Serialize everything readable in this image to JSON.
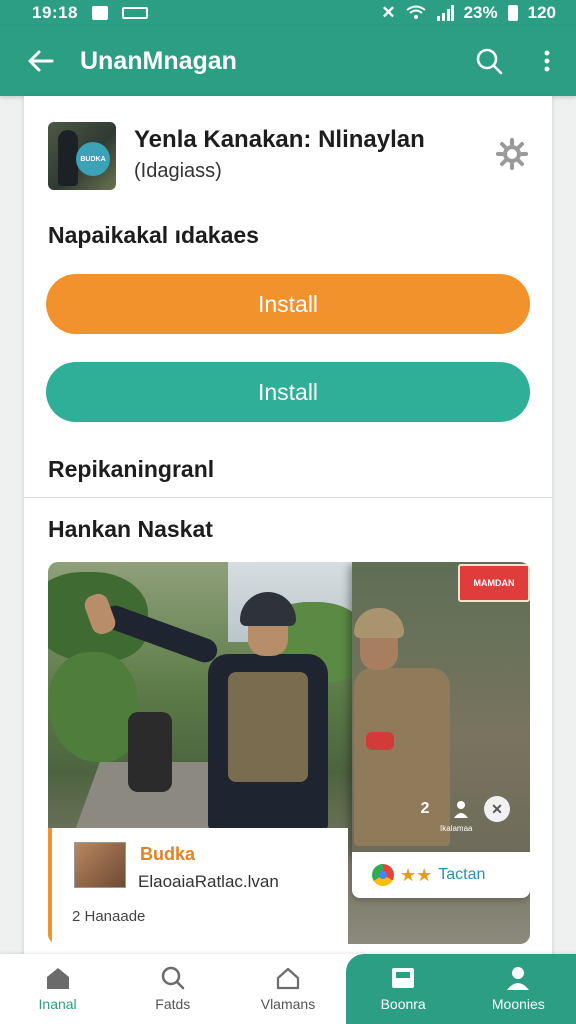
{
  "status_bar": {
    "time": "19:18",
    "battery": "23%",
    "right_value": "120"
  },
  "app_bar": {
    "title": "UnanMnagan",
    "back_icon": "arrow-left-icon",
    "search_icon": "search-icon",
    "menu_icon": "more-vert-icon"
  },
  "app": {
    "name": "Yenla Kanakan: Nlinaylan",
    "subtitle": "(Idagiass)",
    "icon_badge": "BUDKA",
    "settings_icon": "gear-icon"
  },
  "section_1": "Napaikakal ıdakaes",
  "buttons": {
    "install_primary": "Install",
    "install_secondary": "Install"
  },
  "section_2": "Repikaningranl",
  "section_3": "Hankan Naskat",
  "media": {
    "sign_text": "MAMDAN",
    "overlay_caption": "Ikalamaa",
    "overlay_icons": [
      "2",
      "person-icon",
      "close-icon"
    ]
  },
  "info_card": {
    "title": "Budka",
    "subtitle": "ElaoaiaRatlac.lvan",
    "footer": "2 Hanaade"
  },
  "rating_card": {
    "stars": "★★",
    "text": "Tactan"
  },
  "bottom_nav": [
    {
      "label": "Inanal",
      "icon": "home-icon"
    },
    {
      "label": "Fatds",
      "icon": "search-icon"
    },
    {
      "label": "Vlamans",
      "icon": "house-outline-icon"
    },
    {
      "label": "Boonra",
      "icon": "tray-icon"
    },
    {
      "label": "Moonies",
      "icon": "person-icon"
    }
  ],
  "colors": {
    "primary": "#2b9e84",
    "accent_orange": "#f1922d",
    "accent_teal": "#2fae98"
  }
}
